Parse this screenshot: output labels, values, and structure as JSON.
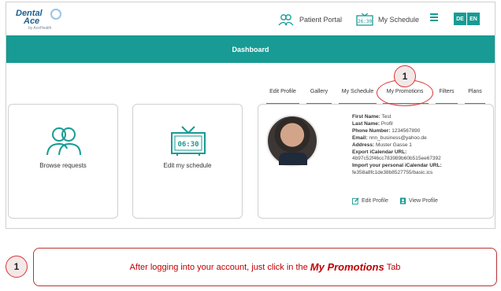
{
  "brand": {
    "logo_line1": "Dental",
    "logo_line2": "Ace",
    "logo_tagline": "by AceHealth"
  },
  "header": {
    "nav": [
      {
        "label": "Patient Portal",
        "icon": "patient-portal-icon"
      },
      {
        "label": "My Schedule",
        "icon": "schedule-clock-icon"
      }
    ],
    "languages": [
      "DE",
      "EN"
    ]
  },
  "dashboard": {
    "title": "Dashboard"
  },
  "tabs": [
    "Edit Profile",
    "Gallery",
    "My Schedule",
    "My Promotions",
    "Filters",
    "Plans"
  ],
  "cards": [
    {
      "label": "Browse requests",
      "icon": "users-icon"
    },
    {
      "label": "Edit my schedule",
      "icon": "tv-clock-icon",
      "clock_text": "06:30"
    }
  ],
  "profile": {
    "fields": [
      {
        "label": "First Name:",
        "value": "Test"
      },
      {
        "label": "Last Name:",
        "value": "Profil"
      },
      {
        "label": "Phone Number:",
        "value": "1234567890"
      },
      {
        "label": "Email:",
        "value": "nnn_business@yahoo.de"
      },
      {
        "label": "Address:",
        "value": "Muster Gasse 1"
      }
    ],
    "ical_label": "Export iCalendar URL:",
    "ical_value": "4b97c52f46cc783989b60b515ee67392",
    "personal_ical_label": "Import your personal iCalendar URL:",
    "personal_ical_value": "fe358a8fc1de38b8527755/basic.ics",
    "edit_link": "Edit Profile",
    "view_link": "View Profile"
  },
  "callout": {
    "number": "1",
    "text_before": "After logging into your account, just click in the",
    "text_emphasis": "My Promotions",
    "text_after": "Tab",
    "accent_color": "#dd3333"
  },
  "colors": {
    "teal": "#179b94"
  }
}
